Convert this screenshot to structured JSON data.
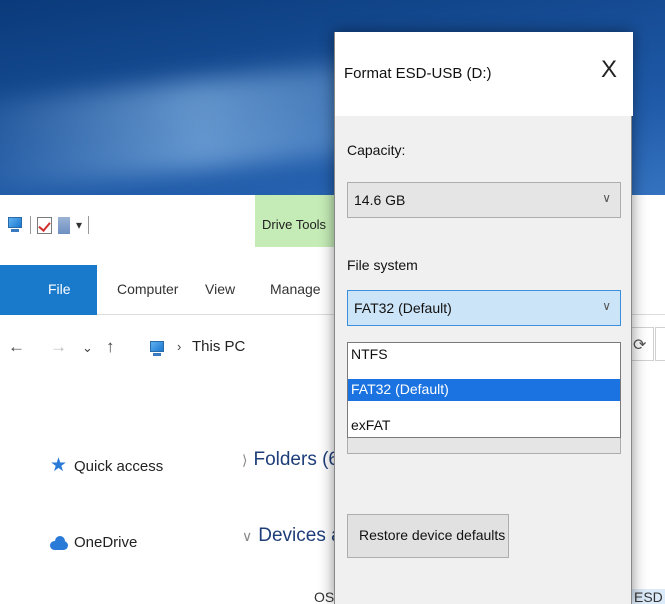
{
  "explorer": {
    "drive_tools_label": "Drive Tools",
    "tabs": {
      "file": "File",
      "computer": "Computer",
      "view": "View",
      "manage": "Manage"
    },
    "address": {
      "back_glyph": "←",
      "forward_glyph": "→",
      "recent_glyph": "⌄",
      "up_glyph": "↑",
      "path": "This PC"
    },
    "navigation": {
      "quick_access": "Quick access",
      "onedrive": "OneDrive"
    },
    "content": {
      "folders_group": "Folders (6",
      "devices_group": "Devices ar",
      "os_label": "OS",
      "esd_label": "ESD"
    }
  },
  "dialog": {
    "title": "Format ESD-USB (D:)",
    "close_glyph": "X",
    "capacity_label": "Capacity:",
    "capacity_value": "14.6 GB",
    "file_system_label": "File system",
    "file_system_value": "FAT32 (Default)",
    "file_system_options": [
      "NTFS",
      "FAT32 (Default)",
      "exFAT"
    ],
    "restore_button": "Restore device defaults"
  },
  "colors": {
    "file_tab": "#1979ca",
    "drive_tools": "#c5ecb6",
    "selection": "#1a73e0",
    "combo_focus": "#cce4f7"
  }
}
